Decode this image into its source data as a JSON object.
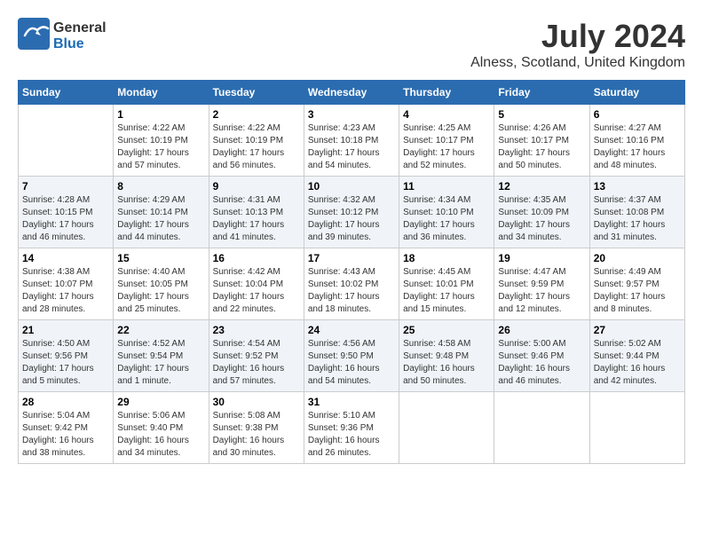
{
  "header": {
    "logo_general": "General",
    "logo_blue": "Blue",
    "month": "July 2024",
    "location": "Alness, Scotland, United Kingdom"
  },
  "days_of_week": [
    "Sunday",
    "Monday",
    "Tuesday",
    "Wednesday",
    "Thursday",
    "Friday",
    "Saturday"
  ],
  "weeks": [
    [
      {
        "day": "",
        "info": ""
      },
      {
        "day": "1",
        "info": "Sunrise: 4:22 AM\nSunset: 10:19 PM\nDaylight: 17 hours\nand 57 minutes."
      },
      {
        "day": "2",
        "info": "Sunrise: 4:22 AM\nSunset: 10:19 PM\nDaylight: 17 hours\nand 56 minutes."
      },
      {
        "day": "3",
        "info": "Sunrise: 4:23 AM\nSunset: 10:18 PM\nDaylight: 17 hours\nand 54 minutes."
      },
      {
        "day": "4",
        "info": "Sunrise: 4:25 AM\nSunset: 10:17 PM\nDaylight: 17 hours\nand 52 minutes."
      },
      {
        "day": "5",
        "info": "Sunrise: 4:26 AM\nSunset: 10:17 PM\nDaylight: 17 hours\nand 50 minutes."
      },
      {
        "day": "6",
        "info": "Sunrise: 4:27 AM\nSunset: 10:16 PM\nDaylight: 17 hours\nand 48 minutes."
      }
    ],
    [
      {
        "day": "7",
        "info": "Sunrise: 4:28 AM\nSunset: 10:15 PM\nDaylight: 17 hours\nand 46 minutes."
      },
      {
        "day": "8",
        "info": "Sunrise: 4:29 AM\nSunset: 10:14 PM\nDaylight: 17 hours\nand 44 minutes."
      },
      {
        "day": "9",
        "info": "Sunrise: 4:31 AM\nSunset: 10:13 PM\nDaylight: 17 hours\nand 41 minutes."
      },
      {
        "day": "10",
        "info": "Sunrise: 4:32 AM\nSunset: 10:12 PM\nDaylight: 17 hours\nand 39 minutes."
      },
      {
        "day": "11",
        "info": "Sunrise: 4:34 AM\nSunset: 10:10 PM\nDaylight: 17 hours\nand 36 minutes."
      },
      {
        "day": "12",
        "info": "Sunrise: 4:35 AM\nSunset: 10:09 PM\nDaylight: 17 hours\nand 34 minutes."
      },
      {
        "day": "13",
        "info": "Sunrise: 4:37 AM\nSunset: 10:08 PM\nDaylight: 17 hours\nand 31 minutes."
      }
    ],
    [
      {
        "day": "14",
        "info": "Sunrise: 4:38 AM\nSunset: 10:07 PM\nDaylight: 17 hours\nand 28 minutes."
      },
      {
        "day": "15",
        "info": "Sunrise: 4:40 AM\nSunset: 10:05 PM\nDaylight: 17 hours\nand 25 minutes."
      },
      {
        "day": "16",
        "info": "Sunrise: 4:42 AM\nSunset: 10:04 PM\nDaylight: 17 hours\nand 22 minutes."
      },
      {
        "day": "17",
        "info": "Sunrise: 4:43 AM\nSunset: 10:02 PM\nDaylight: 17 hours\nand 18 minutes."
      },
      {
        "day": "18",
        "info": "Sunrise: 4:45 AM\nSunset: 10:01 PM\nDaylight: 17 hours\nand 15 minutes."
      },
      {
        "day": "19",
        "info": "Sunrise: 4:47 AM\nSunset: 9:59 PM\nDaylight: 17 hours\nand 12 minutes."
      },
      {
        "day": "20",
        "info": "Sunrise: 4:49 AM\nSunset: 9:57 PM\nDaylight: 17 hours\nand 8 minutes."
      }
    ],
    [
      {
        "day": "21",
        "info": "Sunrise: 4:50 AM\nSunset: 9:56 PM\nDaylight: 17 hours\nand 5 minutes."
      },
      {
        "day": "22",
        "info": "Sunrise: 4:52 AM\nSunset: 9:54 PM\nDaylight: 17 hours\nand 1 minute."
      },
      {
        "day": "23",
        "info": "Sunrise: 4:54 AM\nSunset: 9:52 PM\nDaylight: 16 hours\nand 57 minutes."
      },
      {
        "day": "24",
        "info": "Sunrise: 4:56 AM\nSunset: 9:50 PM\nDaylight: 16 hours\nand 54 minutes."
      },
      {
        "day": "25",
        "info": "Sunrise: 4:58 AM\nSunset: 9:48 PM\nDaylight: 16 hours\nand 50 minutes."
      },
      {
        "day": "26",
        "info": "Sunrise: 5:00 AM\nSunset: 9:46 PM\nDaylight: 16 hours\nand 46 minutes."
      },
      {
        "day": "27",
        "info": "Sunrise: 5:02 AM\nSunset: 9:44 PM\nDaylight: 16 hours\nand 42 minutes."
      }
    ],
    [
      {
        "day": "28",
        "info": "Sunrise: 5:04 AM\nSunset: 9:42 PM\nDaylight: 16 hours\nand 38 minutes."
      },
      {
        "day": "29",
        "info": "Sunrise: 5:06 AM\nSunset: 9:40 PM\nDaylight: 16 hours\nand 34 minutes."
      },
      {
        "day": "30",
        "info": "Sunrise: 5:08 AM\nSunset: 9:38 PM\nDaylight: 16 hours\nand 30 minutes."
      },
      {
        "day": "31",
        "info": "Sunrise: 5:10 AM\nSunset: 9:36 PM\nDaylight: 16 hours\nand 26 minutes."
      },
      {
        "day": "",
        "info": ""
      },
      {
        "day": "",
        "info": ""
      },
      {
        "day": "",
        "info": ""
      }
    ]
  ]
}
